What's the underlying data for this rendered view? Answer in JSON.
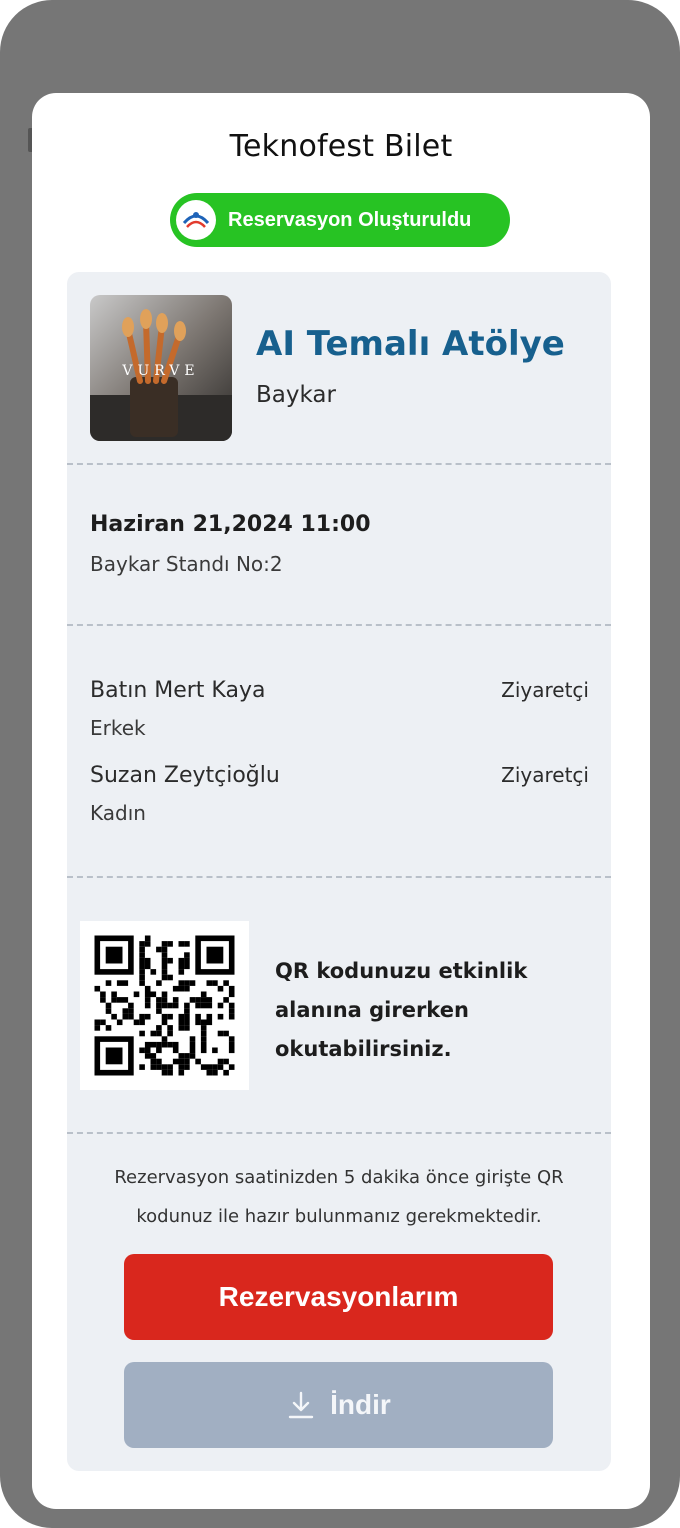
{
  "modal": {
    "title": "Teknofest Bilet",
    "status_badge": "Reservasyon Oluşturuldu"
  },
  "event": {
    "image_label": "VURVE",
    "name": "AI Temalı Atölye",
    "organizer": "Baykar",
    "date": "Haziran 21,2024 11:00",
    "location": "Baykar Standı No:2"
  },
  "attendees": [
    {
      "name": "Batın Mert Kaya",
      "gender": "Erkek",
      "role": "Ziyaretçi"
    },
    {
      "name": "Suzan Zeytçioğlu",
      "gender": "Kadın",
      "role": "Ziyaretçi"
    }
  ],
  "qr": {
    "instruction": "QR kodunuzu etkinlik alanına girerken okutabilirsiniz."
  },
  "note": "Rezervasyon saatinizden 5 dakika önce girişte QR kodunuz ile hazır bulunmanız gerekmektedir.",
  "buttons": {
    "reservations": "Rezervasyonlarım",
    "download": "İndir"
  },
  "icons": [
    "teknofest-logo-icon",
    "download-icon",
    "qr-code-icon"
  ],
  "colors": {
    "status_green": "#27c323",
    "event_title": "#17608e",
    "primary_button": "#d9271d",
    "disabled_button": "#a1afc2",
    "ticket_bg": "#edf0f4"
  }
}
